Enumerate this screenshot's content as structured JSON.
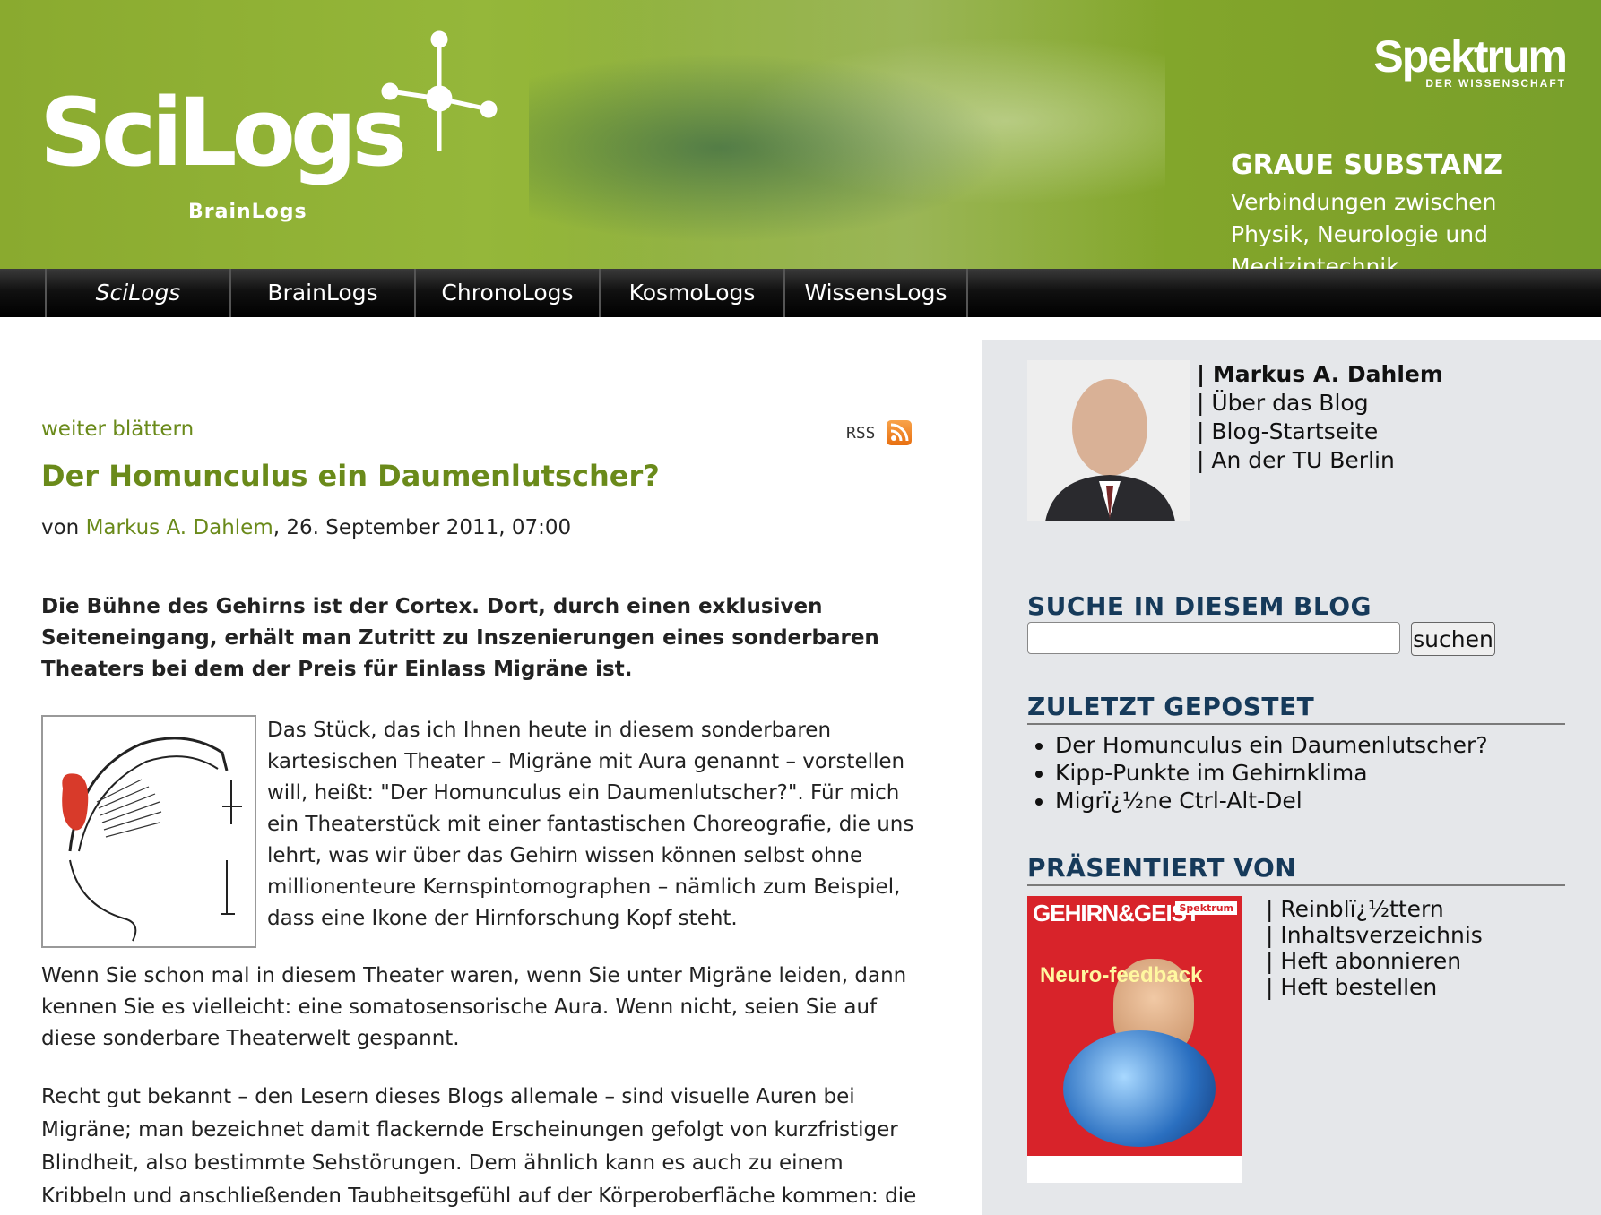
{
  "header": {
    "logo_text": "SciLogs",
    "logo_sub": "BrainLogs",
    "publisher_name": "Spektrum",
    "publisher_sub": "DER WISSENSCHAFT",
    "blog_title": "GRAUE SUBSTANZ",
    "blog_tagline": "Verbindungen zwischen Physik, Neurologie und Medizintechnik"
  },
  "nav": {
    "items": [
      {
        "label": "SciLogs"
      },
      {
        "label": "BrainLogs"
      },
      {
        "label": "ChronoLogs"
      },
      {
        "label": "KosmoLogs"
      },
      {
        "label": "WissensLogs"
      }
    ]
  },
  "article": {
    "weiter_label": "weiter blättern",
    "rss_label": "RSS",
    "title": "Der Homunculus ein Daumenlutscher?",
    "byline_prefix": "von ",
    "author": "Markus A. Dahlem",
    "date": ", 26. September 2011, 07:00",
    "lead": "Die Bühne des Gehirns ist der Cortex. Dort, durch einen exklusiven Seiteneingang, erhält man Zutritt zu Inszenierungen eines sonderbaren Theaters bei dem der Preis für Einlass Migräne ist.",
    "para1": "Das Stück, das ich Ihnen heute in diesem sonderbaren kartesischen Theater – Migräne mit Aura genannt – vorstellen will, heißt: \"Der Homunculus ein Daumenlutscher?\". Für mich ein Theaterstück mit einer fantastischen Choreografie, die uns lehrt, was wir über das Gehirn wissen können selbst ohne millionenteure Kernspintomographen – nämlich zum Beispiel, dass eine Ikone der Hirnforschung Kopf steht.",
    "para2": "Wenn Sie schon mal in diesem Theater waren, wenn Sie unter Migräne leiden, dann kennen Sie es vielleicht: eine somatosensorische Aura. Wenn nicht, seien Sie auf diese sonderbare Theaterwelt gespannt.",
    "para3": "Recht gut bekannt – den Lesern dieses Blogs allemale – sind visuelle Auren bei Migräne; man bezeichnet damit flackernde Erscheinungen gefolgt von kurzfristiger Blindheit, also bestimmte Sehstörungen. Dem ähnlich kann es auch zu einem Kribbeln und anschließenden Taubheitsgefühl auf der Körperoberfläche kommen: die"
  },
  "sidebar": {
    "author_links": [
      "| Markus A. Dahlem",
      "| Über das Blog",
      "| Blog-Startseite",
      "| An der TU Berlin"
    ],
    "search_heading": "SUCHE IN DIESEM BLOG",
    "search_value": "",
    "search_button": "suchen",
    "recent_heading": "ZULETZT GEPOSTET",
    "recent_posts": [
      "Der Homunculus ein Daumenlutscher?",
      "Kipp-Punkte im Gehirnklima",
      "Migrï¿½ne Ctrl-Alt-Del"
    ],
    "presented_heading": "PRÄSENTIERT VON",
    "magazine": {
      "title": "GEHIRN&GEIST",
      "badge": "Spektrum",
      "headline": "Neuro-feedback"
    },
    "magazine_links": [
      "| Reinblï¿½ttern",
      "| Inhaltsverzeichnis",
      "| Heft abonnieren",
      "| Heft bestellen"
    ]
  },
  "colors": {
    "header_green": "#8aaa2f",
    "link_green": "#6a8a1a",
    "sidebar_heading": "#163a5a",
    "sidebar_bg": "#e5e7ea",
    "nav_bg": "#111111"
  }
}
